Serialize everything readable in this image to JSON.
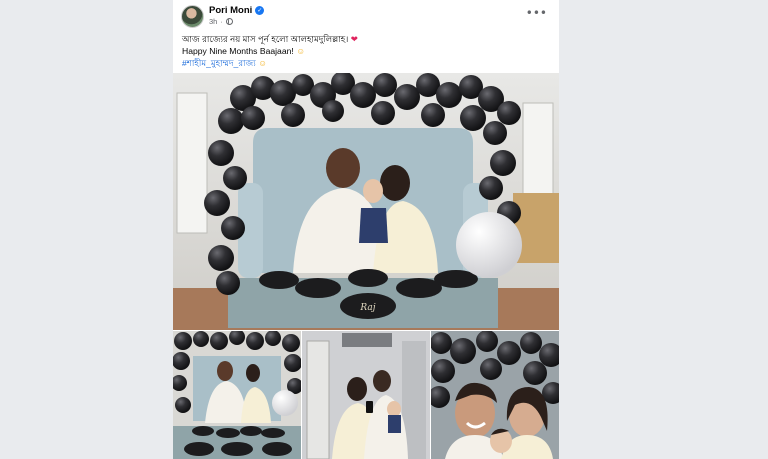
{
  "post": {
    "author": "Pori Moni",
    "time": "3h",
    "dot": "·",
    "more_icon": "•••",
    "caption_line1": "আজ রাজ্যের নয় মাস পূর্ন হলো আলহামদুলিল্লাহ। ",
    "caption_line1_emoji": "❤",
    "caption_line2": "Happy Nine Months Baajaan! ",
    "caption_line2_emoji": "☺",
    "caption_line3": "#শাহীম_মুহাম্মদ_রাজ্য ",
    "caption_line3_emoji": "☺",
    "cake_text": "Raj"
  },
  "colors": {
    "link": "#216fdb",
    "verified": "#1877f2",
    "balloon": "#2b2b2e"
  },
  "icons": {
    "verified": "verified-badge-icon",
    "privacy": "globe-icon",
    "menu": "more-options-icon"
  }
}
